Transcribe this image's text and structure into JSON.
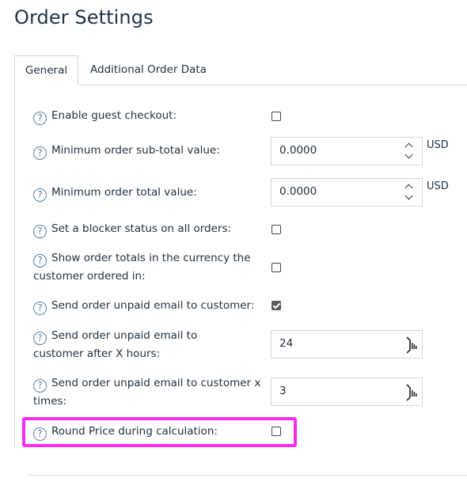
{
  "page": {
    "title": "Order Settings"
  },
  "tabs": [
    {
      "label": "General",
      "active": true
    },
    {
      "label": "Additional Order Data",
      "active": false
    }
  ],
  "settings": {
    "guest_checkout": {
      "label": "Enable guest checkout:",
      "checked": false
    },
    "min_subtotal": {
      "label": "Minimum order sub-total value:",
      "value": "0.0000",
      "unit": "USD"
    },
    "min_total": {
      "label": "Minimum order total value:",
      "value": "0.0000",
      "unit": "USD"
    },
    "blocker_status": {
      "label": "Set a blocker status on all orders:",
      "checked": false
    },
    "currency_totals": {
      "label": "Show order totals in the currency the customer ordered in:",
      "checked": false
    },
    "unpaid_email": {
      "label": "Send order unpaid email to customer:",
      "checked": true
    },
    "unpaid_email_hours": {
      "label": "Send order unpaid email to customer after X hours:",
      "value": "24"
    },
    "unpaid_email_times": {
      "label": "Send order unpaid email to customer x times:",
      "value": "3"
    },
    "round_price": {
      "label": "Round Price during calculation:",
      "checked": false
    }
  },
  "icons": {
    "help": "question-circle-icon",
    "help_glyph": "?"
  },
  "colors": {
    "highlight": "#ff2cf0",
    "help_icon": "#5b7fa3",
    "border": "#cfd8e0"
  }
}
